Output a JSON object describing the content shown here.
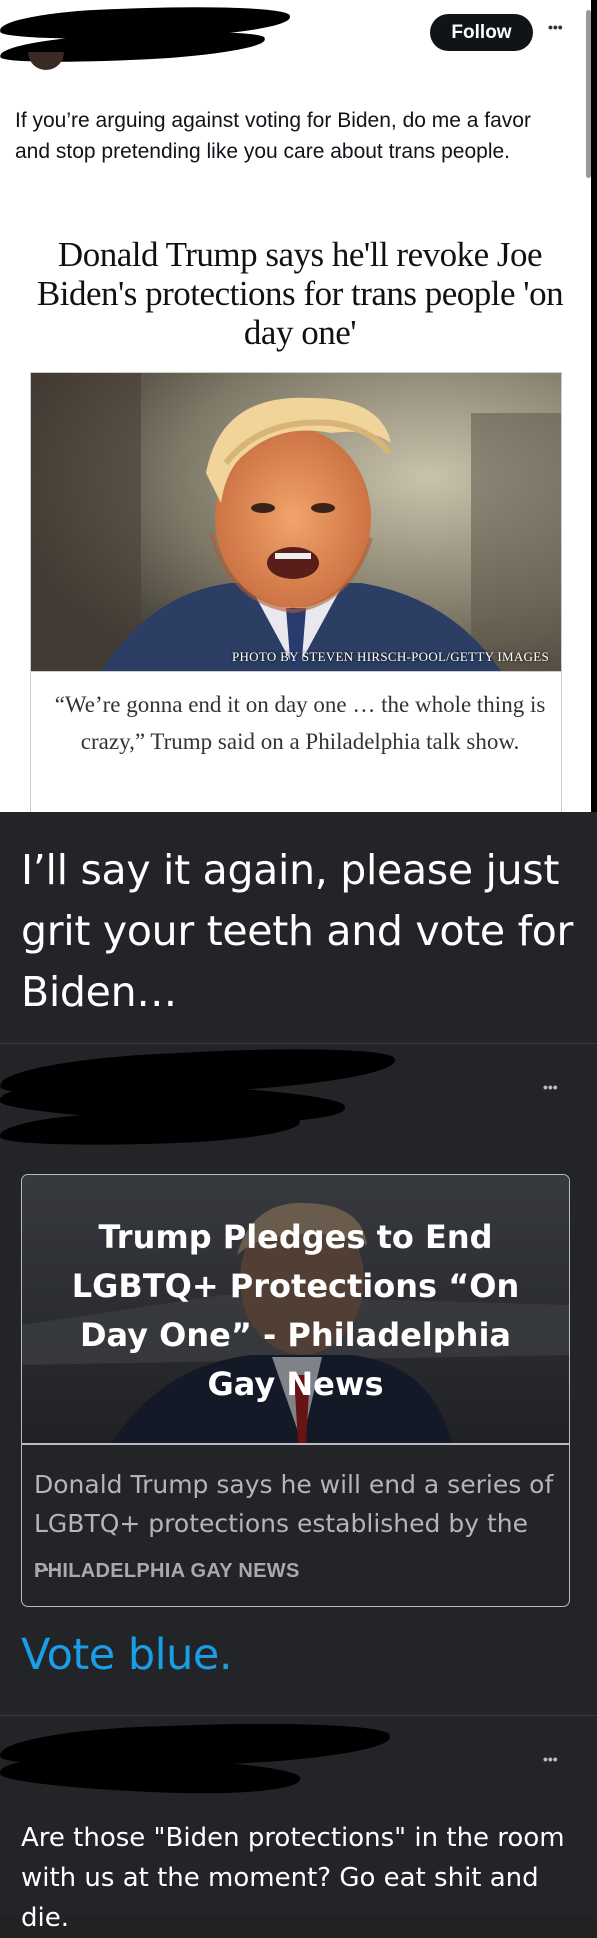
{
  "tweet": {
    "follow_label": "Follow",
    "more_label": "•••",
    "text": "If you’re arguing against voting for Biden, do me a favor and stop pretending like you care about trans people.",
    "article": {
      "headline": "Donald Trump says he'll revoke Joe Biden's protections for trans people 'on day one'",
      "photo_credit": "PHOTO BY STEVEN HIRSCH-POOL/GETTY IMAGES",
      "caption": "“We’re gonna end it on day one … the whole thing is crazy,” Trump said on a Philadelphia talk show."
    }
  },
  "post": {
    "text": "I’ll say it again, please just grit your teeth and vote for Biden…"
  },
  "reblog": {
    "more_label": "•••",
    "card": {
      "title": "Trump Pledges to End LGBTQ+ Protections “On Day One” - Philadelphia Gay News",
      "description": "Donald Trump says he will end a series of LGBTQ+ protections established by the …",
      "source": "PHILADELPHIA GAY NEWS"
    },
    "tagline": "Vote blue."
  },
  "reply": {
    "more_label": "•••",
    "text": "Are those \"Biden protections\" in the room with us at the moment? Go eat shit and die."
  },
  "colors": {
    "follow_bg": "#0f1419",
    "dark_bg": "#222427",
    "link_blue": "#1a9ee6"
  }
}
